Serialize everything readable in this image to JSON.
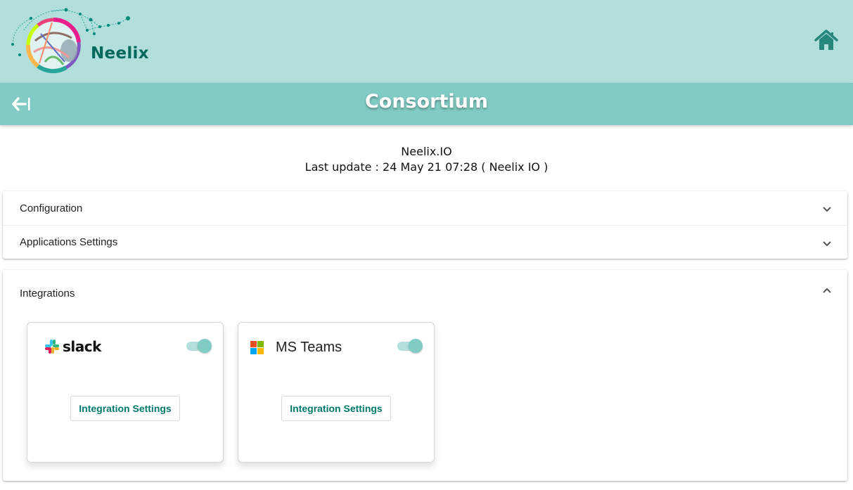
{
  "header": {
    "brand": "Neelix",
    "home_icon": "home-icon"
  },
  "titlebar": {
    "title": "Consortium",
    "back_icon": "back-arrow-icon"
  },
  "org": {
    "name": "Neelix.IO",
    "last_update": "Last update : 24 May 21 07:28 ( Neelix IO )"
  },
  "panels": [
    {
      "label": "Configuration",
      "expanded": false
    },
    {
      "label": "Applications Settings",
      "expanded": false
    }
  ],
  "integrations": {
    "label": "Integrations",
    "expanded": true,
    "cards": [
      {
        "logo_text": "slack",
        "enabled": true,
        "button": "Integration Settings"
      },
      {
        "logo_text": "MS Teams",
        "enabled": true,
        "button": "Integration Settings"
      }
    ]
  },
  "colors": {
    "topbar": "#b2dfdb",
    "titlebar": "#80cbc4",
    "accent": "#00796b",
    "brand_text": "#00695c"
  }
}
